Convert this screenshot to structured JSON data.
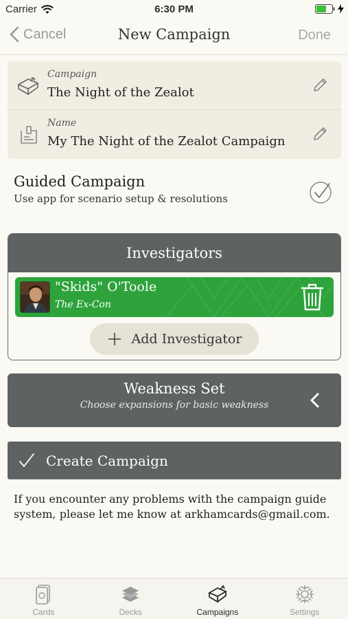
{
  "status_bar": {
    "carrier": "Carrier",
    "time": "6:30 PM"
  },
  "nav": {
    "back_label": "Cancel",
    "title": "New Campaign",
    "done_label": "Done"
  },
  "campaign_field": {
    "label": "Campaign",
    "value": "The Night of the Zealot",
    "icon": "campaign-box-icon"
  },
  "name_field": {
    "label": "Name",
    "value": "My The Night of the Zealot Campaign",
    "icon": "name-card-icon"
  },
  "guided": {
    "title": "Guided Campaign",
    "subtitle": "Use app for scenario setup & resolutions",
    "checked": true
  },
  "investigators": {
    "header": "Investigators",
    "items": [
      {
        "name": "\"Skids\" O'Toole",
        "subtitle": "The Ex-Con",
        "color": "#2ea33c"
      }
    ],
    "add_label": "Add Investigator"
  },
  "weakness": {
    "title": "Weakness Set",
    "subtitle": "Choose expansions for basic weakness"
  },
  "create": {
    "label": "Create Campaign"
  },
  "help_text": "If you encounter any problems with the campaign guide system, please let me know at arkhamcards@gmail.com.",
  "tabs": [
    {
      "label": "Cards",
      "icon": "cards-icon",
      "active": false
    },
    {
      "label": "Decks",
      "icon": "decks-icon",
      "active": false
    },
    {
      "label": "Campaigns",
      "icon": "campaigns-icon",
      "active": true
    },
    {
      "label": "Settings",
      "icon": "settings-icon",
      "active": false
    }
  ],
  "colors": {
    "header_gray": "#5e6263",
    "card_bg": "#f1ede2",
    "page_bg": "#fbf9f3",
    "investigator_green": "#2ea33c"
  }
}
